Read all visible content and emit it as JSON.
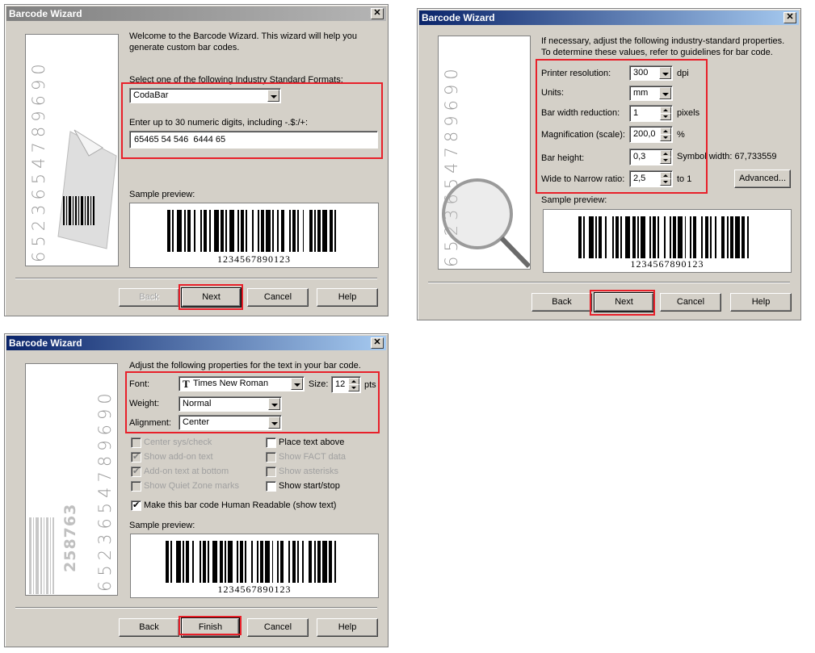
{
  "dialog1": {
    "title": "Barcode Wizard",
    "sidebar_digits": "6523654789690",
    "intro": "Welcome to the Barcode Wizard.  This wizard will help you generate custom bar codes.",
    "formats_label": "Select one of the following Industry Standard Formats:",
    "format_value": "CodaBar",
    "digits_label": "Enter up to 30 numeric digits, including -.$:/+:",
    "digits_value": "65465 54 546  6444 65",
    "preview_label": "Sample preview:",
    "preview_text": "1234567890123",
    "buttons": {
      "back": "Back",
      "next": "Next",
      "cancel": "Cancel",
      "help": "Help"
    }
  },
  "dialog2": {
    "title": "Barcode Wizard",
    "sidebar_digits": "6523654789690",
    "intro": "If necessary, adjust the following industry-standard properties. To determine these values, refer to guidelines for bar code.",
    "printer_resolution": {
      "label": "Printer resolution:",
      "value": "300",
      "unit": "dpi"
    },
    "units": {
      "label": "Units:",
      "value": "mm"
    },
    "bar_width_reduction": {
      "label": "Bar width reduction:",
      "value": "1",
      "unit": "pixels"
    },
    "magnification": {
      "label": "Magnification (scale):",
      "value": "200,0",
      "unit": "%"
    },
    "bar_height": {
      "label": "Bar height:",
      "value": "0,3"
    },
    "symbol_width": "Symbol width:  67,733559",
    "wide_narrow": {
      "label": "Wide to Narrow ratio:",
      "value": "2,5",
      "unit": "to 1"
    },
    "advanced_button": "Advanced...",
    "preview_label": "Sample preview:",
    "preview_text": "1234567890123",
    "buttons": {
      "back": "Back",
      "next": "Next",
      "cancel": "Cancel",
      "help": "Help"
    }
  },
  "dialog3": {
    "title": "Barcode Wizard",
    "sidebar_digits": "6523654789690",
    "sidebar_rotated_number": "258763",
    "intro": "Adjust the following properties for the text in your bar code.",
    "font": {
      "label": "Font:",
      "value": "Times New Roman"
    },
    "size": {
      "label": "Size:",
      "value": "12",
      "unit": "pts"
    },
    "weight": {
      "label": "Weight:",
      "value": "Normal"
    },
    "alignment": {
      "label": "Alignment:",
      "value": "Center"
    },
    "checkboxes_left": [
      {
        "label": "Center sys/check",
        "checked": false,
        "enabled": false
      },
      {
        "label": "Show add-on text",
        "checked": true,
        "enabled": false
      },
      {
        "label": "Add-on text at bottom",
        "checked": true,
        "enabled": false
      },
      {
        "label": "Show Quiet Zone marks",
        "checked": false,
        "enabled": false
      }
    ],
    "checkboxes_right": [
      {
        "label": "Place text above",
        "checked": false,
        "enabled": true
      },
      {
        "label": "Show FACT data",
        "checked": false,
        "enabled": false
      },
      {
        "label": "Show asterisks",
        "checked": false,
        "enabled": false
      },
      {
        "label": "Show start/stop",
        "checked": false,
        "enabled": true
      }
    ],
    "human_readable": {
      "label": "Make this bar code Human Readable (show text)",
      "checked": true
    },
    "preview_label": "Sample preview:",
    "preview_text": "1234567890123",
    "buttons": {
      "back": "Back",
      "finish": "Finish",
      "cancel": "Cancel",
      "help": "Help"
    }
  },
  "colors": {
    "highlight": "#e8202a",
    "dialog_bg": "#d4d0c8",
    "active_title": "#0a246a"
  }
}
